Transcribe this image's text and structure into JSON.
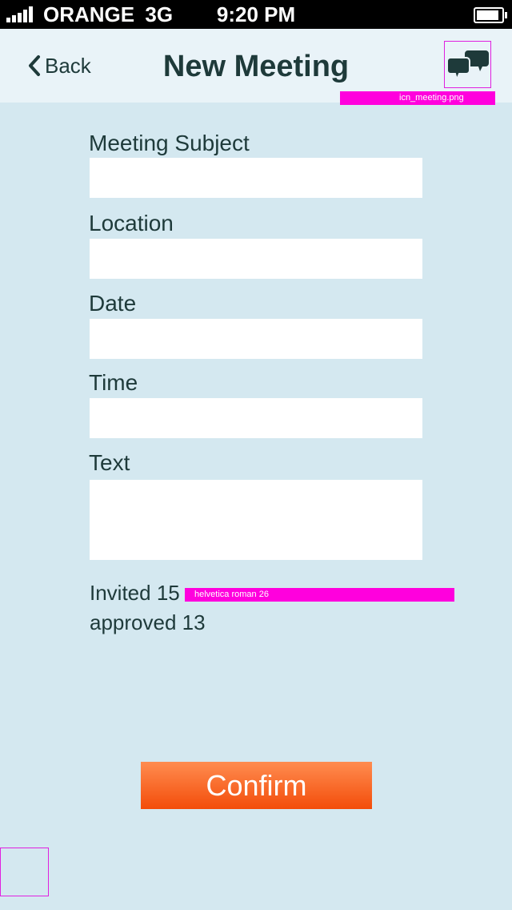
{
  "status_bar": {
    "carrier": "ORANGE",
    "network": "3G",
    "time": "9:20 PM",
    "battery_level": 0.9
  },
  "nav": {
    "back_label": "Back",
    "title": "New Meeting",
    "icon_annotation": "icn_meeting.png"
  },
  "form": {
    "fields": [
      {
        "label": "Meeting Subject",
        "value": ""
      },
      {
        "label": "Location",
        "value": ""
      },
      {
        "label": "Date",
        "value": ""
      },
      {
        "label": "Time",
        "value": ""
      },
      {
        "label": "Text",
        "value": ""
      }
    ]
  },
  "stats": {
    "invited": "Invited 15",
    "approved": "approved 13",
    "font_annotation": "helvetica roman 26"
  },
  "confirm_label": "Confirm",
  "colors": {
    "background": "#d4e8f0",
    "nav_background": "#e9f3f8",
    "text": "#1e3a3a",
    "confirm_top": "#ff8c50",
    "confirm_bottom": "#f34d0a",
    "annotation": "#ff00dd"
  }
}
